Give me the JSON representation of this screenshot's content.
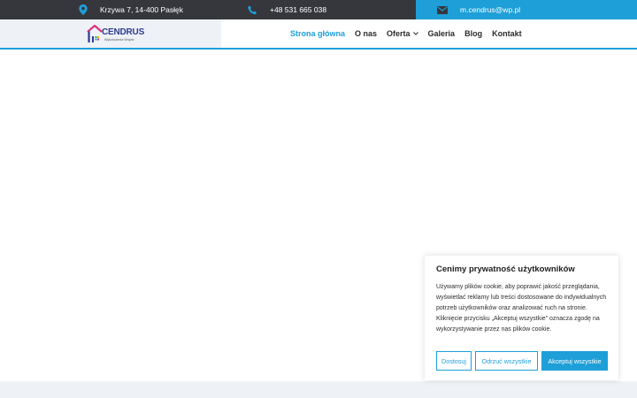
{
  "topbar": {
    "address": "Krzywa 7, 14-400 Pasłęk",
    "phone": "+48 531 665 038",
    "email": "m.cendrus@wp.pl",
    "address_icon": "map-pin-icon",
    "phone_icon": "phone-icon",
    "email_icon": "envelope-icon"
  },
  "logo": {
    "name": "CENDRUS",
    "tagline": "Wykończenia Wnętrz"
  },
  "nav": {
    "items": [
      {
        "label": "Strona główna",
        "active": true
      },
      {
        "label": "O nas"
      },
      {
        "label": "Oferta",
        "has_dropdown": true
      },
      {
        "label": "Galeria"
      },
      {
        "label": "Blog"
      },
      {
        "label": "Kontakt"
      }
    ]
  },
  "cookie": {
    "title": "Cenimy prywatność użytkowników",
    "text": "Używamy plików cookie, aby poprawić jakość przeglądania, wyświetlać reklamy lub treści dostosowane do indywidualnych potrzeb użytkowników oraz analizować ruch na stronie. Kliknięcie przycisku „Akceptuj wszystkie” oznacza zgodę na wykorzystywanie przez nas plików cookie.",
    "btn_customize": "Dostosuj",
    "btn_reject": "Odrzuć wszystkie",
    "btn_accept": "Akceptuj wszystkie"
  },
  "colors": {
    "accent": "#1e9fd8",
    "topbar": "#35373c",
    "logo_text": "#2c3b8f"
  }
}
